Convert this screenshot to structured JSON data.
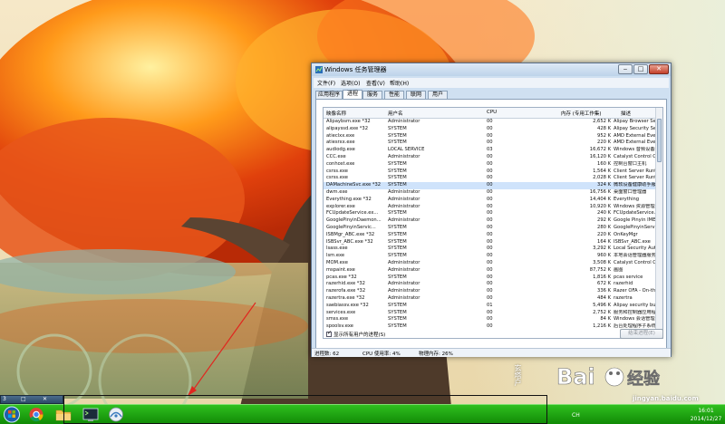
{
  "window": {
    "title": "Windows 任务管理器",
    "minimize": "‒",
    "maximize": "□",
    "close": "✕",
    "menu": [
      "文件(F)",
      "选项(O)",
      "查看(V)",
      "帮助(H)"
    ],
    "tabs": [
      "应用程序",
      "进程",
      "服务",
      "性能",
      "联网",
      "用户"
    ],
    "active_tab": "进程",
    "columns": {
      "name": "映像名称",
      "user": "用户名",
      "cpu": "CPU",
      "mem": "内存 (专用工作集)",
      "desc": "描述"
    },
    "show_all_checked": true,
    "show_all_label": "显示所有用户的进程(S)",
    "end_process_label": "结束进程(E)",
    "status": {
      "processes": "进程数: 62",
      "cpu": "CPU 使用率: 4%",
      "mem": "物理内存: 26%"
    }
  },
  "processes": [
    {
      "name": "Alipaybsm.exe *32",
      "user": "Administrator",
      "cpu": "00",
      "mem": "2,652 K",
      "desc": "Alipay Browser Securi"
    },
    {
      "name": "alipayssd.exe *32",
      "user": "SYSTEM",
      "cpu": "00",
      "mem": "428 K",
      "desc": "Alipay Security Serv"
    },
    {
      "name": "atieclxx.exe",
      "user": "SYSTEM",
      "cpu": "00",
      "mem": "952 K",
      "desc": "AMD External Events C"
    },
    {
      "name": "atiesrxx.exe",
      "user": "SYSTEM",
      "cpu": "00",
      "mem": "220 K",
      "desc": "AMD External Events S"
    },
    {
      "name": "audiodg.exe",
      "user": "LOCAL SERVICE",
      "cpu": "03",
      "mem": "16,672 K",
      "desc": "Windows 音频设备图形隔"
    },
    {
      "name": "CCC.exe",
      "user": "Administrator",
      "cpu": "00",
      "mem": "16,120 K",
      "desc": "Catalyst Control Cent"
    },
    {
      "name": "conhost.exe",
      "user": "SYSTEM",
      "cpu": "00",
      "mem": "160 K",
      "desc": "控制台窗口主机"
    },
    {
      "name": "csrss.exe",
      "user": "SYSTEM",
      "cpu": "00",
      "mem": "1,564 K",
      "desc": "Client Server Runtime"
    },
    {
      "name": "csrss.exe",
      "user": "SYSTEM",
      "cpu": "00",
      "mem": "2,028 K",
      "desc": "Client Server Runtime"
    },
    {
      "name": "DAMachineSvc.exe *32",
      "user": "SYSTEM",
      "cpu": "00",
      "mem": "324 K",
      "desc": "微软设备健康助手服务"
    },
    {
      "name": "dwm.exe",
      "user": "Administrator",
      "cpu": "00",
      "mem": "16,756 K",
      "desc": "桌面窗口管理器"
    },
    {
      "name": "Everything.exe *32",
      "user": "Administrator",
      "cpu": "00",
      "mem": "14,404 K",
      "desc": "Everything"
    },
    {
      "name": "explorer.exe",
      "user": "Administrator",
      "cpu": "00",
      "mem": "10,920 K",
      "desc": "Windows 资源管理器"
    },
    {
      "name": "FCUpdateService.ex...",
      "user": "SYSTEM",
      "cpu": "00",
      "mem": "240 K",
      "desc": "FCUpdateService.exe"
    },
    {
      "name": "GooglePinyinDaemon...",
      "user": "Administrator",
      "cpu": "00",
      "mem": "292 K",
      "desc": "Google Pinyin IME"
    },
    {
      "name": "GooglePinyinServic...",
      "user": "SYSTEM",
      "cpu": "00",
      "mem": "280 K",
      "desc": "GooglePinyinService.e"
    },
    {
      "name": "ISBMgr_ABC.exe *32",
      "user": "SYSTEM",
      "cpu": "00",
      "mem": "220 K",
      "desc": "OnKeyMgr"
    },
    {
      "name": "ISBSvr_ABC.exe *32",
      "user": "SYSTEM",
      "cpu": "00",
      "mem": "164 K",
      "desc": "ISBSvr_ABC.exe"
    },
    {
      "name": "lsass.exe",
      "user": "SYSTEM",
      "cpu": "00",
      "mem": "3,292 K",
      "desc": "Local Security Author"
    },
    {
      "name": "lsm.exe",
      "user": "SYSTEM",
      "cpu": "00",
      "mem": "960 K",
      "desc": "本地会话管理器服务"
    },
    {
      "name": "MOM.exe",
      "user": "Administrator",
      "cpu": "00",
      "mem": "3,508 K",
      "desc": "Catalyst Control Cent"
    },
    {
      "name": "mspaint.exe",
      "user": "Administrator",
      "cpu": "00",
      "mem": "87,752 K",
      "desc": "画图"
    },
    {
      "name": "pcas.exe *32",
      "user": "SYSTEM",
      "cpu": "00",
      "mem": "1,816 K",
      "desc": "pcas service"
    },
    {
      "name": "razerhid.exe *32",
      "user": "Administrator",
      "cpu": "00",
      "mem": "672 K",
      "desc": "razerhid"
    },
    {
      "name": "razerofa.exe *32",
      "user": "Administrator",
      "cpu": "00",
      "mem": "336 K",
      "desc": "Razer OFA - On-the-F1"
    },
    {
      "name": "razertra.exe *32",
      "user": "Administrator",
      "cpu": "00",
      "mem": "484 K",
      "desc": "razertra"
    },
    {
      "name": "saebiassv.exe *32",
      "user": "SYSTEM",
      "cpu": "01",
      "mem": "5,496 K",
      "desc": "Alipay security busin"
    },
    {
      "name": "services.exe",
      "user": "SYSTEM",
      "cpu": "00",
      "mem": "2,752 K",
      "desc": "服务和控制器应用程序"
    },
    {
      "name": "smss.exe",
      "user": "SYSTEM",
      "cpu": "00",
      "mem": "84 K",
      "desc": "Windows 会话管理器"
    },
    {
      "name": "spoolsv.exe",
      "user": "SYSTEM",
      "cpu": "00",
      "mem": "1,216 K",
      "desc": "后台处理程序子系统应用"
    }
  ],
  "taskbar": {
    "apps": [
      "start-orb-icon",
      "chrome-icon",
      "folder-icon",
      "terminal-icon",
      "network-icon"
    ],
    "lang": "CH",
    "time": "16:01",
    "date": "2014/12/27"
  },
  "mini_pane": {
    "a": "3",
    "b": "□",
    "c": "✕"
  },
  "watermark": {
    "brand": "Bai经验",
    "url": "jingyan.baidu.com",
    "vtext": "玄塔户"
  },
  "colors": {
    "taskbar": "#1fa812",
    "selection": "#cfe3fb",
    "arrow": "#e0271f"
  }
}
